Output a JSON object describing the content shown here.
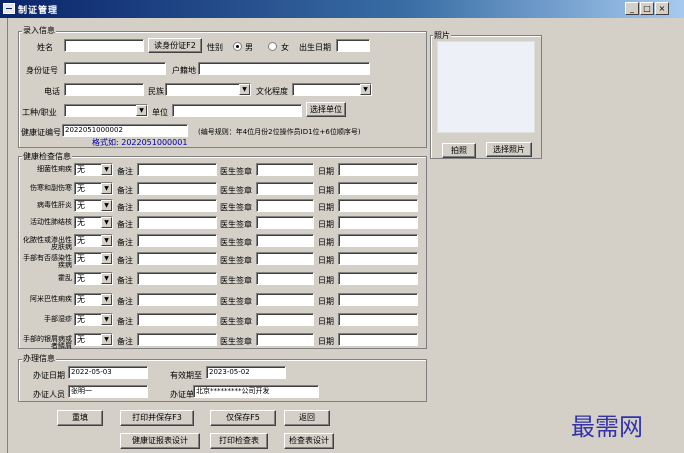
{
  "window": {
    "title": "制证管理",
    "min_label": "_",
    "max_label": "□",
    "close_label": "×"
  },
  "entry": {
    "group_label": "录入信息",
    "name_label": "姓名",
    "name_value": "",
    "read_id_button": "读身份证F2",
    "gender_label": "性别",
    "male_label": "男",
    "female_label": "女",
    "birth_label": "出生日期",
    "birth_value": "",
    "idcard_label": "身份证号",
    "idcard_value": "",
    "hukou_label": "户籍地",
    "hukou_value": "",
    "phone_label": "电话",
    "phone_value": "",
    "ethnic_label": "民族",
    "ethnic_value": "",
    "edu_label": "文化程度",
    "edu_value": "",
    "job_label": "工种/职业",
    "job_value": "",
    "unit_label": "单位",
    "unit_value": "",
    "select_unit_button": "选择单位",
    "cert_no_label": "健康证编号",
    "cert_no_value": "2022051000002",
    "cert_rule": "(编号规则：年4位月份2位操作员ID1位+6位顺序号)",
    "format_example": "格式如: 2022051000001"
  },
  "photo": {
    "group_label": "照片",
    "capture_button": "拍照",
    "choose_button": "选择照片"
  },
  "exam": {
    "group_label": "健康检查信息",
    "note_label": "备注",
    "doctor_label": "医生签章",
    "date_label": "日期",
    "rows": [
      {
        "label": "细菌性痢疾",
        "value": "无"
      },
      {
        "label": "伤寒和副伤寒",
        "value": "无"
      },
      {
        "label": "病毒性肝炎",
        "value": "无"
      },
      {
        "label": "活动性肺结核",
        "value": "无"
      },
      {
        "label": "化脓性或渗出性皮肤病",
        "value": "无"
      },
      {
        "label": "手部有否感染性疾病",
        "value": "无"
      },
      {
        "label": "霍乱",
        "value": "无"
      },
      {
        "label": "阿米巴性痢疾",
        "value": "无"
      },
      {
        "label": "手部湿疹",
        "value": "无"
      },
      {
        "label": "手部的银屑病或者鳞屑",
        "value": "无"
      }
    ]
  },
  "process": {
    "group_label": "办理信息",
    "date_label": "办证日期",
    "date_value": "2022-05-03",
    "valid_label": "有效期至",
    "valid_value": "2023-05-02",
    "person_label": "办证人员",
    "person_value": "张明一",
    "unit_label": "办证单位",
    "unit_value": "北京*********公司开发"
  },
  "actions": {
    "reset": "重填",
    "print_save": "打印并保存F3",
    "save_only": "仅保存F5",
    "back": "返回",
    "cert_design": "健康证报表设计",
    "print_exam": "打印检查表",
    "exam_design": "检查表设计"
  },
  "watermark": "最需网"
}
